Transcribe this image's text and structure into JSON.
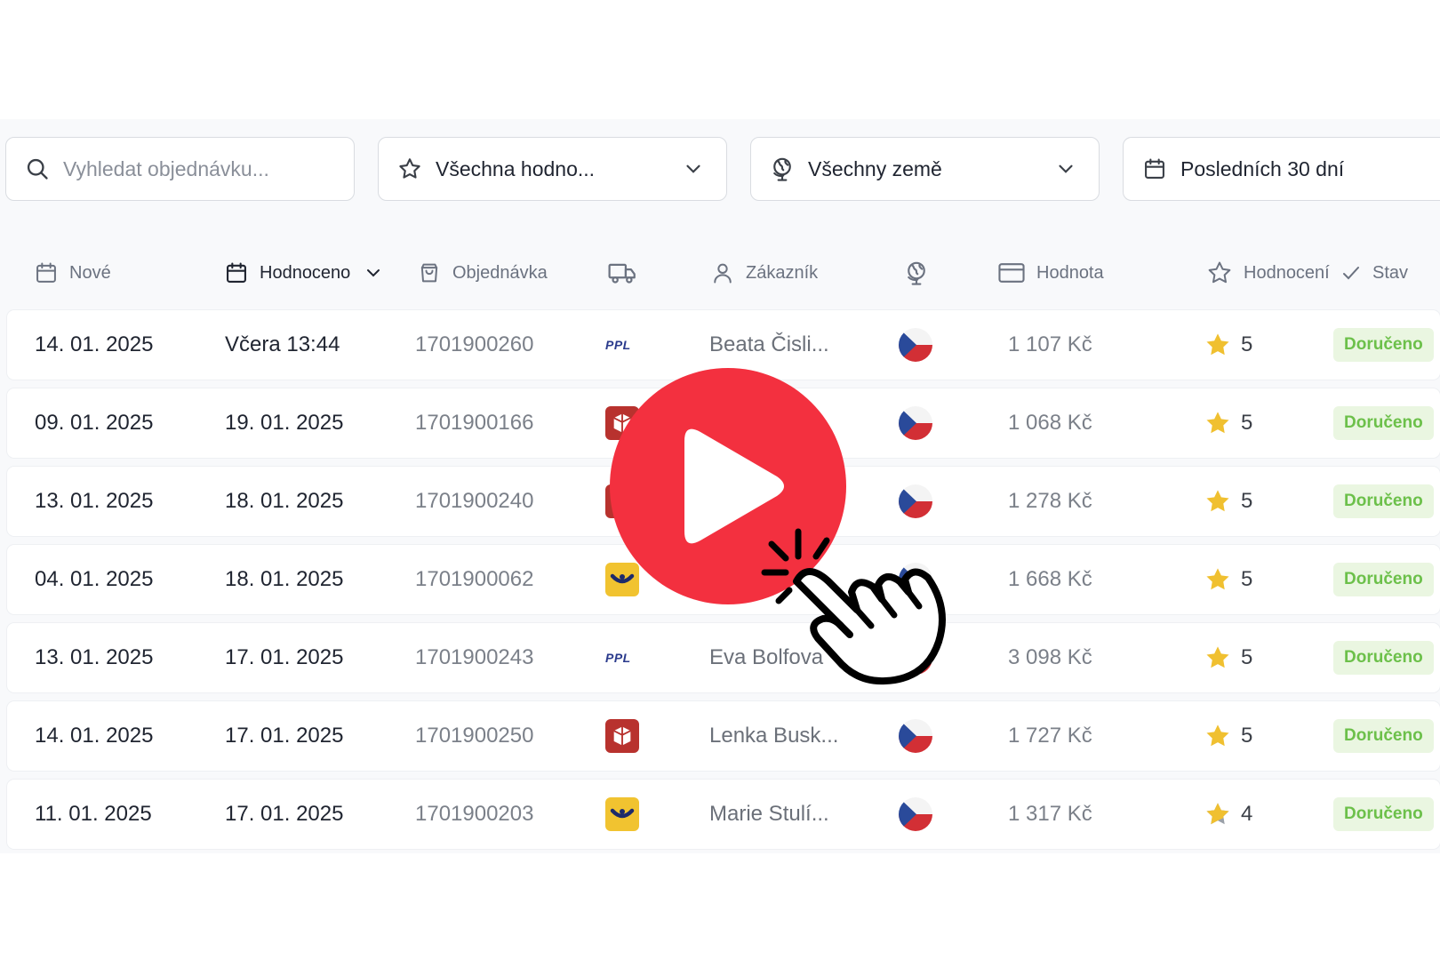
{
  "filters": {
    "search": {
      "placeholder": "Vyhledat objednávku...",
      "icon": "search-icon"
    },
    "rating": {
      "value": "Všechna hodno...",
      "icon": "star-icon"
    },
    "country": {
      "value": "Všechny země",
      "icon": "globe-icon"
    },
    "date": {
      "value": "Posledních 30 dní",
      "icon": "calendar-icon"
    }
  },
  "table": {
    "headers": {
      "new": "Nové",
      "rated": "Hodnoceno",
      "order": "Objednávka",
      "customer": "Zákazník",
      "value": "Hodnota",
      "rating": "Hodnocení",
      "status": "Stav"
    },
    "rows": [
      {
        "new": "14. 01. 2025",
        "rated": "Včera 13:44",
        "order": "1701900260",
        "carrier": "PPL",
        "customer": "Beata Čisli...",
        "country": "Czech Republic",
        "value": "1 107 Kč",
        "rating": "5",
        "status": "Doručeno"
      },
      {
        "new": "09. 01. 2025",
        "rated": "19. 01. 2025",
        "order": "1701900166",
        "carrier": "Zásilkovna",
        "customer": "",
        "country": "Czech Republic",
        "value": "1 068 Kč",
        "rating": "5",
        "status": "Doručeno"
      },
      {
        "new": "13. 01. 2025",
        "rated": "18. 01. 2025",
        "order": "1701900240",
        "carrier": "Zásilkovna",
        "customer": "",
        "country": "Czech Republic",
        "value": "1 278 Kč",
        "rating": "5",
        "status": "Doručeno"
      },
      {
        "new": "04. 01. 2025",
        "rated": "18. 01. 2025",
        "order": "1701900062",
        "carrier": "Česká pošta",
        "customer": "",
        "country": "Czech Republic",
        "value": "1 668 Kč",
        "rating": "5",
        "status": "Doručeno"
      },
      {
        "new": "13. 01. 2025",
        "rated": "17. 01. 2025",
        "order": "1701900243",
        "carrier": "PPL",
        "customer": "Eva Bolfova",
        "country": "Czech Republic",
        "value": "3 098 Kč",
        "rating": "5",
        "status": "Doručeno"
      },
      {
        "new": "14. 01. 2025",
        "rated": "17. 01. 2025",
        "order": "1701900250",
        "carrier": "Zásilkovna",
        "customer": "Lenka Busk...",
        "country": "Czech Republic",
        "value": "1 727 Kč",
        "rating": "5",
        "status": "Doručeno"
      },
      {
        "new": "11. 01. 2025",
        "rated": "17. 01. 2025",
        "order": "1701900203",
        "carrier": "Česká pošta",
        "customer": "Marie Stulí...",
        "country": "Czech Republic",
        "value": "1 317 Kč",
        "rating": "4",
        "status": "Doručeno"
      }
    ]
  },
  "ppl_logo_text": "PPL",
  "colors": {
    "accent": "#f3303f",
    "status_bg": "#eaf6e1",
    "status_text": "#6cc04a",
    "star": "#f0c030"
  }
}
